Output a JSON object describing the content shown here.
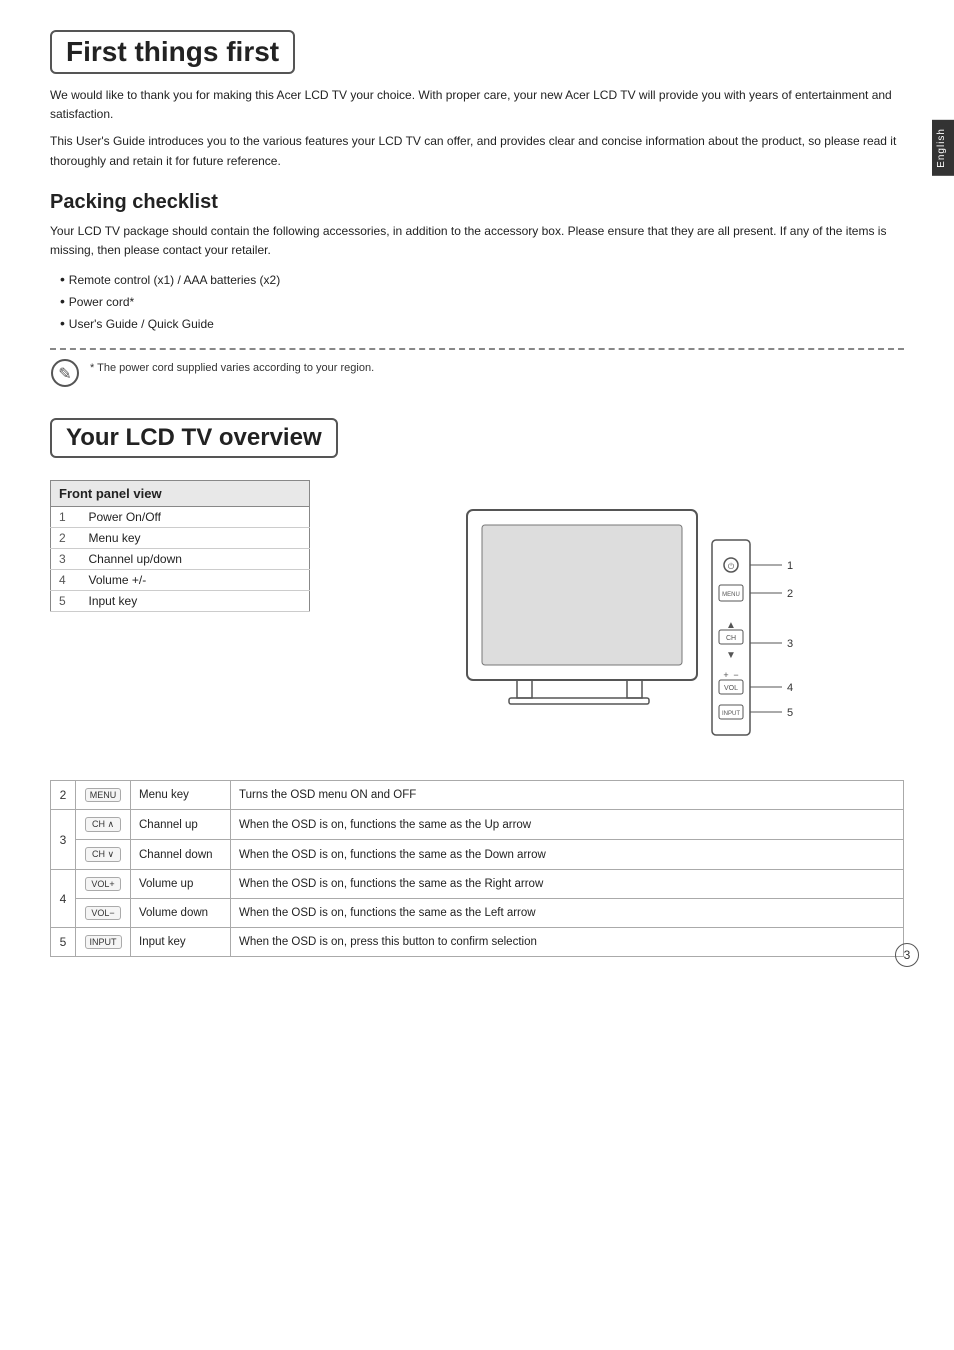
{
  "side_tab": {
    "label": "English"
  },
  "section1": {
    "title": "First things first",
    "intro1": "We would like to thank you for making this Acer LCD TV your choice. With proper care, your new Acer LCD TV will provide you with years of entertainment and satisfaction.",
    "intro2": "This User's Guide introduces you to the various features your LCD TV can offer, and provides clear and concise information about the product, so please read it thoroughly and retain it for future reference.",
    "packing": {
      "title": "Packing checklist",
      "intro": "Your LCD TV package should contain the following accessories, in addition to the accessory box. Please ensure that they are all present. If any of the items is missing, then please contact your retailer.",
      "items": [
        "Remote control (x1) / AAA batteries (x2)",
        "Power cord*",
        "User's Guide / Quick Guide"
      ],
      "note": "* The power cord supplied varies according to your region."
    }
  },
  "section2": {
    "title": "Your LCD TV overview",
    "front_panel": {
      "heading": "Front panel view",
      "rows": [
        {
          "num": "1",
          "label": "Power On/Off"
        },
        {
          "num": "2",
          "label": "Menu key"
        },
        {
          "num": "3",
          "label": "Channel up/down"
        },
        {
          "num": "4",
          "label": "Volume +/-"
        },
        {
          "num": "5",
          "label": "Input key"
        }
      ]
    },
    "detail_rows": [
      {
        "num": "2",
        "icon_label": "MENU",
        "key_name": "Menu key",
        "description": "Turns the OSD menu ON and OFF",
        "rowspan": 1
      },
      {
        "num": "3",
        "icon_label1": "CH ∧",
        "icon_label2": "CH ∨",
        "key_name1": "Channel up",
        "key_name2": "Channel down",
        "description1": "When the OSD is on, functions the same as the Up arrow",
        "description2": "When the OSD is on, functions the same as the Down arrow",
        "rowspan": 2
      },
      {
        "num": "4",
        "icon_label1": "VOL+",
        "icon_label2": "VOL−",
        "key_name1": "Volume up",
        "key_name2": "Volume down",
        "description1": "When the OSD is on, functions the same as the Right arrow",
        "description2": "When the OSD is on, functions the same as the Left arrow",
        "rowspan": 2
      },
      {
        "num": "5",
        "icon_label": "INPUT",
        "key_name": "Input key",
        "description": "When the OSD is on, press this button to confirm selection",
        "rowspan": 1
      }
    ]
  },
  "page_number": "3"
}
